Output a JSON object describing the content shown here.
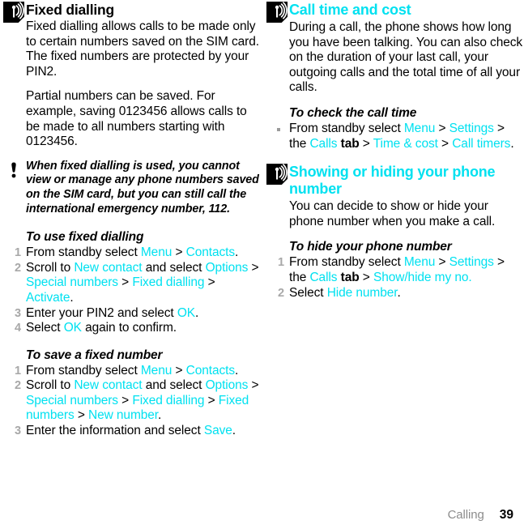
{
  "footer": {
    "chapter": "Calling",
    "page": "39"
  },
  "left_column": {
    "section": {
      "icon": "antenna-signal-icon",
      "title": "Fixed dialling",
      "title_color": "#000000"
    },
    "paragraphs": [
      "Fixed dialling allows calls to be made only to certain numbers saved on the SIM card. The fixed numbers are protected by your PIN2.",
      "Partial numbers can be saved. For example, saving 0123456 allows calls to be made to all numbers starting with 0123456."
    ],
    "note": {
      "icon": "exclamation-mark-icon",
      "text": "When fixed dialling is used, you cannot view or manage any phone numbers saved on the SIM card, but you can still call the international emergency number, 112."
    },
    "procedures": [
      {
        "heading": "To use fixed dialling",
        "steps": [
          [
            {
              "t": "From standby select ",
              "s": "plain"
            },
            {
              "t": "Menu",
              "s": "ui"
            },
            {
              "t": " > ",
              "s": "plain"
            },
            {
              "t": "Contacts",
              "s": "ui"
            },
            {
              "t": ".",
              "s": "plain"
            }
          ],
          [
            {
              "t": "Scroll to ",
              "s": "plain"
            },
            {
              "t": "New contact",
              "s": "ui"
            },
            {
              "t": " and select ",
              "s": "plain"
            },
            {
              "t": "Options",
              "s": "ui"
            },
            {
              "t": " > ",
              "s": "plain"
            },
            {
              "t": "Special numbers",
              "s": "ui"
            },
            {
              "t": " > ",
              "s": "plain"
            },
            {
              "t": "Fixed dialling",
              "s": "ui"
            },
            {
              "t": " > ",
              "s": "plain"
            },
            {
              "t": "Activate",
              "s": "ui"
            },
            {
              "t": ".",
              "s": "plain"
            }
          ],
          [
            {
              "t": "Enter your PIN2 and select ",
              "s": "plain"
            },
            {
              "t": "OK",
              "s": "ui"
            },
            {
              "t": ".",
              "s": "plain"
            }
          ],
          [
            {
              "t": "Select ",
              "s": "plain"
            },
            {
              "t": "OK",
              "s": "ui"
            },
            {
              "t": " again to confirm.",
              "s": "plain"
            }
          ]
        ]
      },
      {
        "heading": "To save a fixed number",
        "steps": [
          [
            {
              "t": "From standby select ",
              "s": "plain"
            },
            {
              "t": "Menu",
              "s": "ui"
            },
            {
              "t": " > ",
              "s": "plain"
            },
            {
              "t": "Contacts",
              "s": "ui"
            },
            {
              "t": ".",
              "s": "plain"
            }
          ],
          [
            {
              "t": "Scroll to ",
              "s": "plain"
            },
            {
              "t": "New contact",
              "s": "ui"
            },
            {
              "t": " and select ",
              "s": "plain"
            },
            {
              "t": "Options",
              "s": "ui"
            },
            {
              "t": " > ",
              "s": "plain"
            },
            {
              "t": "Special numbers",
              "s": "ui"
            },
            {
              "t": " > ",
              "s": "plain"
            },
            {
              "t": "Fixed dialling",
              "s": "ui"
            },
            {
              "t": " > ",
              "s": "plain"
            },
            {
              "t": "Fixed numbers",
              "s": "ui"
            },
            {
              "t": " > ",
              "s": "plain"
            },
            {
              "t": "New number",
              "s": "ui"
            },
            {
              "t": ".",
              "s": "plain"
            }
          ],
          [
            {
              "t": "Enter the information and select ",
              "s": "plain"
            },
            {
              "t": "Save",
              "s": "ui"
            },
            {
              "t": ".",
              "s": "plain"
            }
          ]
        ]
      }
    ]
  },
  "right_column": {
    "sections": [
      {
        "icon": "antenna-signal-icon",
        "title": "Call time and cost",
        "title_color": "#00e1f0",
        "paragraphs": [
          "During a call, the phone shows how long you have been talking. You can also check on the duration of your last call, your outgoing calls and the total time of all your calls."
        ],
        "procedure": {
          "heading": "To check the call time",
          "bullets": [
            [
              {
                "t": "From standby select ",
                "s": "plain"
              },
              {
                "t": "Menu",
                "s": "ui"
              },
              {
                "t": " > ",
                "s": "plain"
              },
              {
                "t": "Settings",
                "s": "ui"
              },
              {
                "t": " > the ",
                "s": "plain"
              },
              {
                "t": "Calls",
                "s": "ui"
              },
              {
                "t": " tab",
                "s": "bold"
              },
              {
                "t": " > ",
                "s": "plain"
              },
              {
                "t": "Time & cost",
                "s": "ui"
              },
              {
                "t": " > ",
                "s": "plain"
              },
              {
                "t": "Call timers",
                "s": "ui"
              },
              {
                "t": ".",
                "s": "plain"
              }
            ]
          ]
        }
      },
      {
        "icon": "antenna-signal-icon",
        "title": "Showing or hiding your phone number",
        "title_color": "#00e1f0",
        "paragraphs": [
          "You can decide to show or hide your phone number when you make a call."
        ],
        "procedure": {
          "heading": "To hide your phone number",
          "steps": [
            [
              {
                "t": "From standby select ",
                "s": "plain"
              },
              {
                "t": "Menu",
                "s": "ui"
              },
              {
                "t": " > ",
                "s": "plain"
              },
              {
                "t": "Settings",
                "s": "ui"
              },
              {
                "t": " > the ",
                "s": "plain"
              },
              {
                "t": "Calls",
                "s": "ui"
              },
              {
                "t": " tab",
                "s": "bold"
              },
              {
                "t": " > ",
                "s": "plain"
              },
              {
                "t": "Show/hide my no.",
                "s": "ui"
              }
            ],
            [
              {
                "t": "Select ",
                "s": "plain"
              },
              {
                "t": "Hide number",
                "s": "ui"
              },
              {
                "t": ".",
                "s": "plain"
              }
            ]
          ]
        }
      }
    ]
  }
}
